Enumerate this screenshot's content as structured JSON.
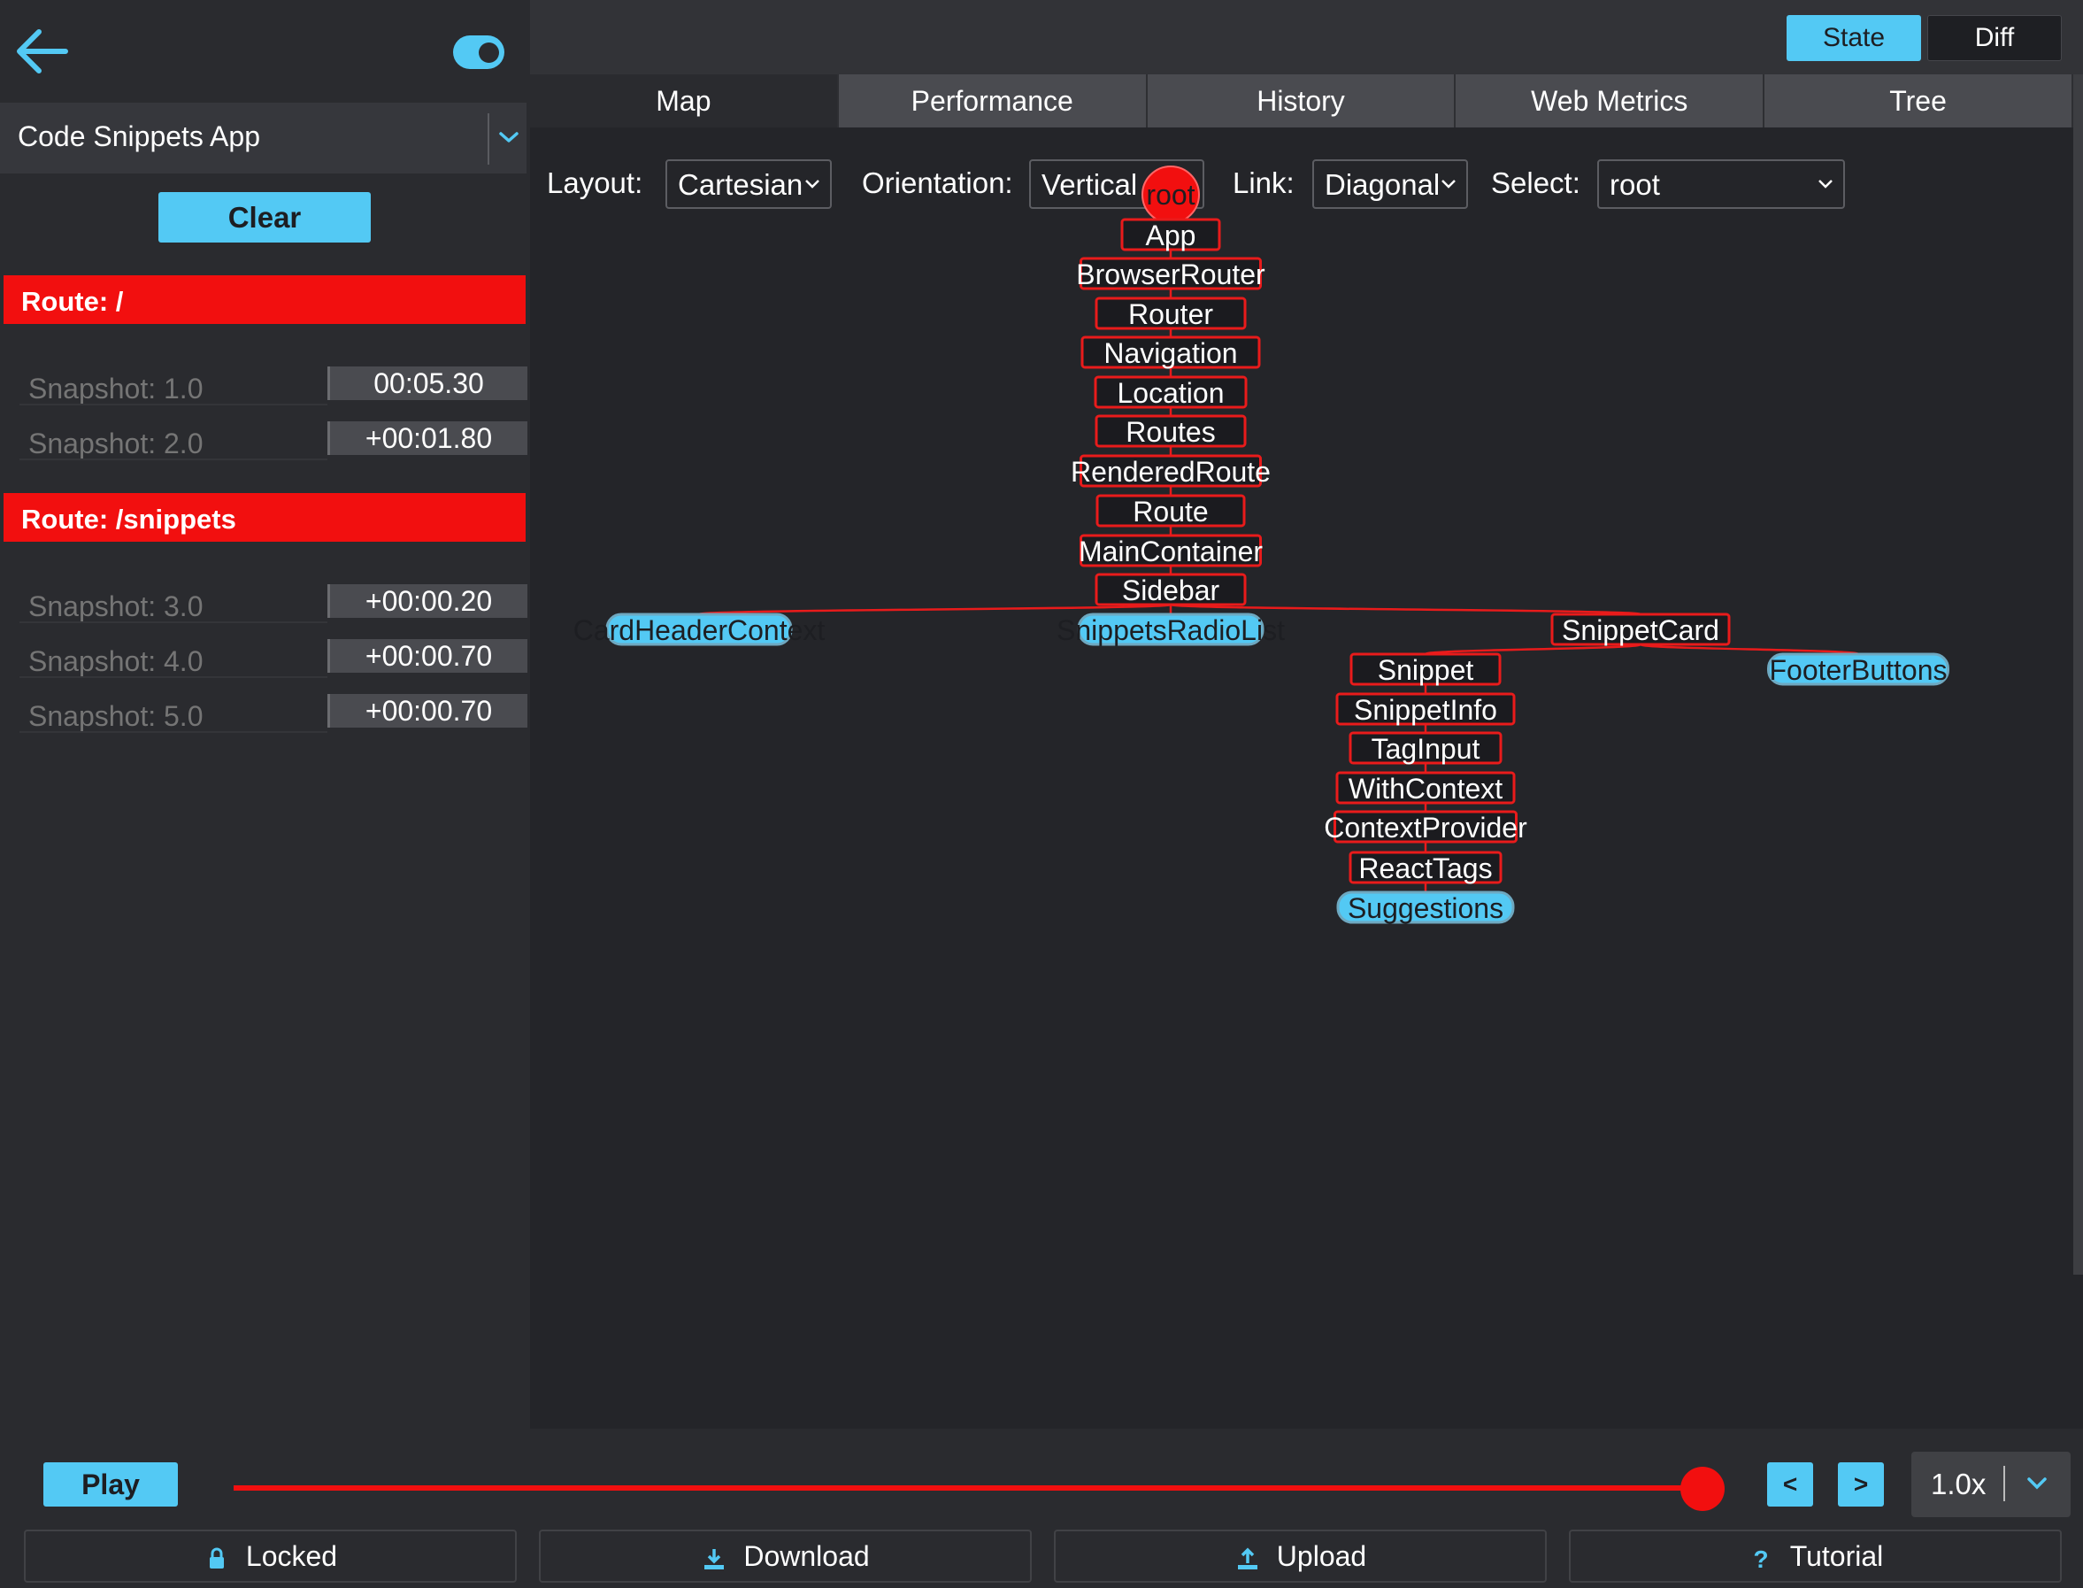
{
  "app": {
    "name": "Code Snippets App",
    "clear_label": "Clear"
  },
  "routes": [
    {
      "label": "Route: /",
      "snapshots": [
        {
          "label": "Snapshot: 1.0",
          "time": "00:05.30"
        },
        {
          "label": "Snapshot: 2.0",
          "time": "+00:01.80"
        }
      ]
    },
    {
      "label": "Route: /snippets",
      "snapshots": [
        {
          "label": "Snapshot: 3.0",
          "time": "+00:00.20"
        },
        {
          "label": "Snapshot: 4.0",
          "time": "+00:00.70"
        },
        {
          "label": "Snapshot: 5.0",
          "time": "+00:00.70"
        }
      ]
    }
  ],
  "header": {
    "state_label": "State",
    "diff_label": "Diff"
  },
  "tabs": [
    "Map",
    "Performance",
    "History",
    "Web Metrics",
    "Tree"
  ],
  "controls": {
    "layout_label": "Layout:",
    "layout_value": "Cartesian",
    "orientation_label": "Orientation:",
    "orientation_value": "Vertical",
    "link_label": "Link:",
    "link_value": "Diagonal",
    "select_label": "Select:",
    "select_value": "root"
  },
  "tree": {
    "root": "root",
    "nodes": [
      {
        "id": "App",
        "label": "App",
        "parent": "root",
        "leaf": false
      },
      {
        "id": "BrowserRouter",
        "label": "BrowserRouter",
        "parent": "App",
        "leaf": false
      },
      {
        "id": "Router",
        "label": "Router",
        "parent": "BrowserRouter",
        "leaf": false
      },
      {
        "id": "Navigation",
        "label": "Navigation",
        "parent": "Router",
        "leaf": false
      },
      {
        "id": "Location",
        "label": "Location",
        "parent": "Navigation",
        "leaf": false
      },
      {
        "id": "Routes",
        "label": "Routes",
        "parent": "Location",
        "leaf": false
      },
      {
        "id": "RenderedRoute",
        "label": "RenderedRoute",
        "parent": "Routes",
        "leaf": false
      },
      {
        "id": "Route",
        "label": "Route",
        "parent": "RenderedRoute",
        "leaf": false
      },
      {
        "id": "MainContainer",
        "label": "MainContainer",
        "parent": "Route",
        "leaf": false
      },
      {
        "id": "Sidebar",
        "label": "Sidebar",
        "parent": "MainContainer",
        "leaf": false
      },
      {
        "id": "CardHeaderContext",
        "label": "CardHeaderContext",
        "parent": "Sidebar",
        "leaf": true
      },
      {
        "id": "SnippetsRadioList",
        "label": "SnippetsRadioList",
        "parent": "Sidebar",
        "leaf": true
      },
      {
        "id": "SnippetCard",
        "label": "SnippetCard",
        "parent": "Sidebar",
        "leaf": false
      },
      {
        "id": "Snippet",
        "label": "Snippet",
        "parent": "SnippetCard",
        "leaf": false
      },
      {
        "id": "FooterButtons",
        "label": "FooterButtons",
        "parent": "SnippetCard",
        "leaf": true
      },
      {
        "id": "SnippetInfo",
        "label": "SnippetInfo",
        "parent": "Snippet",
        "leaf": false
      },
      {
        "id": "TagInput",
        "label": "TagInput",
        "parent": "SnippetInfo",
        "leaf": false
      },
      {
        "id": "WithContext",
        "label": "WithContext",
        "parent": "TagInput",
        "leaf": false
      },
      {
        "id": "ContextProvider",
        "label": "ContextProvider",
        "parent": "WithContext",
        "leaf": false
      },
      {
        "id": "ReactTags",
        "label": "ReactTags",
        "parent": "ContextProvider",
        "leaf": false
      },
      {
        "id": "Suggestions",
        "label": "Suggestions",
        "parent": "ReactTags",
        "leaf": true
      }
    ]
  },
  "playback": {
    "play_label": "Play",
    "prev_label": "<",
    "next_label": ">",
    "speed": "1.0x",
    "progress": 1.0
  },
  "footer": {
    "locked_label": "Locked",
    "download_label": "Download",
    "upload_label": "Upload",
    "tutorial_label": "Tutorial"
  },
  "colors": {
    "accent": "#53c9f4",
    "route_red": "#f20f0f",
    "node_border": "#e91b1b"
  }
}
